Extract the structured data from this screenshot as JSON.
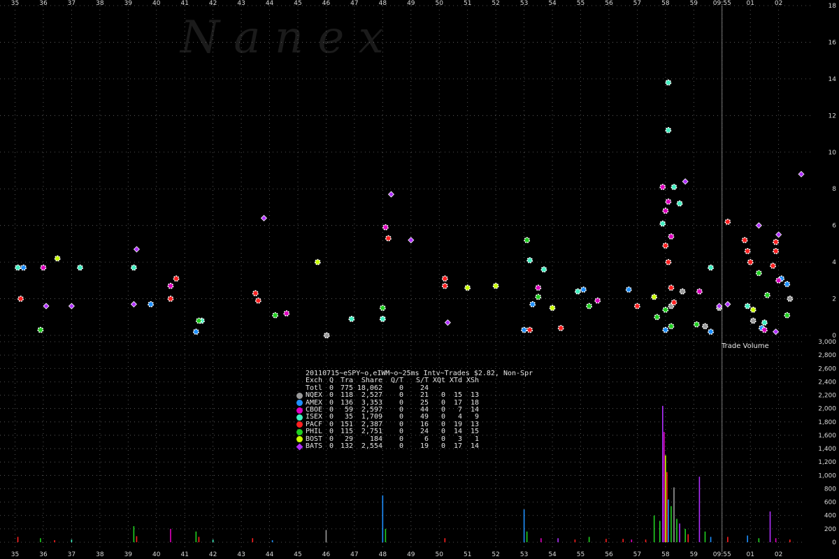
{
  "chart_data": [
    {
      "type": "scatter",
      "title": "",
      "watermark": "N a n e x",
      "xlabel": "",
      "ylabel": "",
      "x_time_labels": [
        "35",
        "36",
        "37",
        "38",
        "39",
        "40",
        "41",
        "42",
        "43",
        "44",
        "45",
        "46",
        "47",
        "48",
        "49",
        "50",
        "51",
        "52",
        "53",
        "54",
        "55",
        "56",
        "57",
        "58",
        "59",
        "09:55",
        "01",
        "02"
      ],
      "ylim": [
        0,
        18
      ],
      "y_tick_labels": [
        "0",
        "2",
        "4",
        "6",
        "8",
        "10",
        "12",
        "14",
        "16",
        "18"
      ],
      "grid": true,
      "marker_line_time": "09:55",
      "series": [
        {
          "name": "NQEX",
          "color": "#9a9a9a",
          "shape": "circle",
          "points": [
            [
              46.02,
              0
            ],
            [
              58.2,
              1.6
            ],
            [
              58.6,
              2.4
            ],
            [
              59.4,
              0.5
            ],
            [
              59.9,
              1.5
            ],
            [
              1.1,
              0.8
            ],
            [
              2.4,
              2.0
            ]
          ]
        },
        {
          "name": "AMEX",
          "color": "#1e90ff",
          "shape": "circle",
          "points": [
            [
              35.3,
              3.7
            ],
            [
              39.8,
              1.7
            ],
            [
              41.4,
              0.2
            ],
            [
              48.0,
              0.9
            ],
            [
              53.0,
              0.3
            ],
            [
              53.3,
              1.7
            ],
            [
              55.1,
              2.5
            ],
            [
              56.7,
              2.5
            ],
            [
              58.0,
              0.3
            ],
            [
              59.6,
              0.2
            ],
            [
              1.4,
              0.4
            ],
            [
              2.1,
              3.1
            ],
            [
              2.3,
              2.8
            ]
          ]
        },
        {
          "name": "CBOE",
          "color": "#e000c0",
          "shape": "circle",
          "points": [
            [
              36.0,
              3.7
            ],
            [
              40.5,
              2.7
            ],
            [
              44.6,
              1.2
            ],
            [
              48.1,
              5.9
            ],
            [
              53.5,
              2.6
            ],
            [
              55.6,
              1.9
            ],
            [
              57.9,
              8.1
            ],
            [
              58.1,
              7.3
            ],
            [
              58.0,
              6.8
            ],
            [
              58.2,
              5.4
            ],
            [
              59.2,
              2.4
            ],
            [
              1.5,
              0.3
            ],
            [
              2.0,
              3.0
            ]
          ]
        },
        {
          "name": "ISEX",
          "color": "#40f0c0",
          "shape": "circle",
          "points": [
            [
              35.1,
              3.7
            ],
            [
              37.3,
              3.7
            ],
            [
              39.2,
              3.7
            ],
            [
              41.6,
              0.8
            ],
            [
              46.9,
              0.9
            ],
            [
              48.0,
              0.9
            ],
            [
              53.2,
              4.1
            ],
            [
              53.7,
              3.6
            ],
            [
              54.9,
              2.4
            ],
            [
              57.9,
              6.1
            ],
            [
              58.3,
              8.1
            ],
            [
              58.5,
              7.2
            ],
            [
              58.1,
              11.2
            ],
            [
              58.1,
              13.8
            ],
            [
              59.6,
              3.7
            ],
            [
              0.9,
              1.6
            ],
            [
              1.5,
              0.7
            ]
          ]
        },
        {
          "name": "PACF",
          "color": "#ff2020",
          "shape": "circle",
          "points": [
            [
              35.2,
              2.0
            ],
            [
              40.5,
              2.0
            ],
            [
              40.7,
              3.1
            ],
            [
              43.5,
              2.3
            ],
            [
              43.6,
              1.9
            ],
            [
              48.2,
              5.3
            ],
            [
              50.2,
              2.7
            ],
            [
              50.2,
              3.1
            ],
            [
              53.2,
              0.3
            ],
            [
              54.3,
              0.4
            ],
            [
              57.0,
              1.6
            ],
            [
              58.0,
              4.9
            ],
            [
              58.1,
              4.0
            ],
            [
              58.2,
              2.6
            ],
            [
              58.3,
              1.8
            ],
            [
              0.2,
              6.2
            ],
            [
              0.8,
              5.2
            ],
            [
              0.9,
              4.6
            ],
            [
              1.0,
              4.0
            ],
            [
              1.9,
              4.6
            ],
            [
              1.8,
              3.8
            ],
            [
              1.9,
              5.1
            ]
          ]
        },
        {
          "name": "PHIL",
          "color": "#20d020",
          "shape": "circle",
          "points": [
            [
              35.9,
              0.3
            ],
            [
              41.5,
              0.8
            ],
            [
              44.2,
              1.1
            ],
            [
              48.0,
              1.5
            ],
            [
              53.1,
              5.2
            ],
            [
              53.5,
              2.1
            ],
            [
              55.3,
              1.6
            ],
            [
              57.7,
              1.0
            ],
            [
              58.0,
              1.4
            ],
            [
              58.2,
              0.5
            ],
            [
              59.1,
              0.6
            ],
            [
              1.3,
              3.4
            ],
            [
              1.6,
              2.2
            ],
            [
              2.3,
              1.1
            ]
          ]
        },
        {
          "name": "BOST",
          "color": "#c8ff00",
          "shape": "circle",
          "points": [
            [
              36.5,
              4.2
            ],
            [
              45.7,
              4.0
            ],
            [
              51.0,
              2.6
            ],
            [
              52.0,
              2.7
            ],
            [
              54.0,
              1.5
            ],
            [
              57.6,
              2.1
            ],
            [
              1.1,
              1.4
            ]
          ]
        },
        {
          "name": "BATS",
          "color": "#b030ff",
          "shape": "diamond",
          "points": [
            [
              36.1,
              1.6
            ],
            [
              37.0,
              1.6
            ],
            [
              39.2,
              1.7
            ],
            [
              39.3,
              4.7
            ],
            [
              43.8,
              6.4
            ],
            [
              48.3,
              7.7
            ],
            [
              49.0,
              5.2
            ],
            [
              50.3,
              0.7
            ],
            [
              58.7,
              8.4
            ],
            [
              59.9,
              1.6
            ],
            [
              0.2,
              1.7
            ],
            [
              1.3,
              6.0
            ],
            [
              1.9,
              0.2
            ],
            [
              2.0,
              5.5
            ],
            [
              2.8,
              8.8
            ]
          ]
        }
      ]
    },
    {
      "type": "bar",
      "title": "Trade Volume",
      "ylim": [
        0,
        3000
      ],
      "y_tick_labels": [
        "0",
        "200",
        "400",
        "600",
        "800",
        "1,000",
        "1,200",
        "1,400",
        "1,600",
        "1,800",
        "2,000",
        "2,200",
        "2,400",
        "2,600",
        "2,800",
        "3,000"
      ],
      "x_time_labels": [
        "35",
        "36",
        "37",
        "38",
        "39",
        "40",
        "41",
        "42",
        "43",
        "44",
        "45",
        "46",
        "47",
        "48",
        "49",
        "50",
        "51",
        "52",
        "53",
        "54",
        "55",
        "56",
        "57",
        "58",
        "59",
        "09:55",
        "01",
        "02"
      ],
      "bars": [
        {
          "t": 35.1,
          "v": 80,
          "color": "#ff2020"
        },
        {
          "t": 35.9,
          "v": 60,
          "color": "#20d020"
        },
        {
          "t": 36.4,
          "v": 30,
          "color": "#ff2020"
        },
        {
          "t": 37.0,
          "v": 40,
          "color": "#40f0c0"
        },
        {
          "t": 39.2,
          "v": 240,
          "color": "#20d020"
        },
        {
          "t": 39.3,
          "v": 90,
          "color": "#ff2020"
        },
        {
          "t": 40.5,
          "v": 200,
          "color": "#e000c0"
        },
        {
          "t": 41.4,
          "v": 160,
          "color": "#20d020"
        },
        {
          "t": 41.5,
          "v": 80,
          "color": "#ff2020"
        },
        {
          "t": 42.0,
          "v": 40,
          "color": "#40f0c0"
        },
        {
          "t": 43.4,
          "v": 60,
          "color": "#ff2020"
        },
        {
          "t": 44.1,
          "v": 30,
          "color": "#1e90ff"
        },
        {
          "t": 46.0,
          "v": 180,
          "color": "#9a9a9a"
        },
        {
          "t": 48.0,
          "v": 700,
          "color": "#1e90ff"
        },
        {
          "t": 48.1,
          "v": 200,
          "color": "#20d020"
        },
        {
          "t": 50.2,
          "v": 60,
          "color": "#ff2020"
        },
        {
          "t": 53.0,
          "v": 490,
          "color": "#1e90ff"
        },
        {
          "t": 53.1,
          "v": 160,
          "color": "#20d020"
        },
        {
          "t": 53.6,
          "v": 60,
          "color": "#e000c0"
        },
        {
          "t": 54.2,
          "v": 60,
          "color": "#b030ff"
        },
        {
          "t": 54.8,
          "v": 40,
          "color": "#ff2020"
        },
        {
          "t": 55.3,
          "v": 80,
          "color": "#20d020"
        },
        {
          "t": 55.9,
          "v": 50,
          "color": "#ff2020"
        },
        {
          "t": 56.5,
          "v": 50,
          "color": "#ff2020"
        },
        {
          "t": 56.8,
          "v": 40,
          "color": "#e000c0"
        },
        {
          "t": 57.3,
          "v": 40,
          "color": "#ff2020"
        },
        {
          "t": 57.6,
          "v": 400,
          "color": "#20d020"
        },
        {
          "t": 57.8,
          "v": 320,
          "color": "#20d020"
        },
        {
          "t": 57.9,
          "v": 2040,
          "color": "#b030ff"
        },
        {
          "t": 57.95,
          "v": 1650,
          "color": "#e000c0"
        },
        {
          "t": 58.0,
          "v": 1300,
          "color": "#c8ff00"
        },
        {
          "t": 58.05,
          "v": 1050,
          "color": "#ff2020"
        },
        {
          "t": 58.1,
          "v": 640,
          "color": "#1e90ff"
        },
        {
          "t": 58.2,
          "v": 540,
          "color": "#20d020"
        },
        {
          "t": 58.3,
          "v": 820,
          "color": "#9a9a9a"
        },
        {
          "t": 58.4,
          "v": 350,
          "color": "#20d020"
        },
        {
          "t": 58.5,
          "v": 280,
          "color": "#b030ff"
        },
        {
          "t": 58.7,
          "v": 200,
          "color": "#20d020"
        },
        {
          "t": 58.8,
          "v": 120,
          "color": "#ff2020"
        },
        {
          "t": 59.2,
          "v": 980,
          "color": "#b030ff"
        },
        {
          "t": 59.4,
          "v": 160,
          "color": "#20d020"
        },
        {
          "t": 59.6,
          "v": 80,
          "color": "#1e90ff"
        },
        {
          "t": 0.2,
          "v": 80,
          "color": "#ff2020"
        },
        {
          "t": 0.9,
          "v": 100,
          "color": "#1e90ff"
        },
        {
          "t": 1.3,
          "v": 60,
          "color": "#20d020"
        },
        {
          "t": 1.7,
          "v": 460,
          "color": "#b030ff"
        },
        {
          "t": 1.9,
          "v": 60,
          "color": "#e000c0"
        },
        {
          "t": 2.4,
          "v": 40,
          "color": "#ff2020"
        }
      ]
    }
  ],
  "legend": {
    "title": "20110715~eSPY~o,eIWM~o~25ms Intv~Trades $2.82, Non-Spr",
    "header": {
      "exch": "Exch",
      "q": "Q",
      "tra": "Tra",
      "share": "Share",
      "qt": "Q/T",
      "st": "S/T",
      "xqt": "XQt",
      "xtd": "XTd",
      "xsh": "XSh"
    },
    "rows": [
      {
        "exch": "Totl",
        "q": "0",
        "tra": "775",
        "share": "18,062",
        "qt": "0",
        "st": "24",
        "xqt": "",
        "xtd": "",
        "xsh": "",
        "color": "",
        "shape": "none"
      },
      {
        "exch": "NQEX",
        "q": "0",
        "tra": "118",
        "share": "2,527",
        "qt": "0",
        "st": "21",
        "xqt": "0",
        "xtd": "15",
        "xsh": "13",
        "color": "#9a9a9a",
        "shape": "circle"
      },
      {
        "exch": "AMEX",
        "q": "0",
        "tra": "136",
        "share": "3,353",
        "qt": "0",
        "st": "25",
        "xqt": "0",
        "xtd": "17",
        "xsh": "18",
        "color": "#1e90ff",
        "shape": "circle"
      },
      {
        "exch": "CBOE",
        "q": "0",
        "tra": "59",
        "share": "2,597",
        "qt": "0",
        "st": "44",
        "xqt": "0",
        "xtd": "7",
        "xsh": "14",
        "color": "#e000c0",
        "shape": "circle"
      },
      {
        "exch": "ISEX",
        "q": "0",
        "tra": "35",
        "share": "1,709",
        "qt": "0",
        "st": "49",
        "xqt": "0",
        "xtd": "4",
        "xsh": "9",
        "color": "#40f0c0",
        "shape": "circle"
      },
      {
        "exch": "PACF",
        "q": "0",
        "tra": "151",
        "share": "2,387",
        "qt": "0",
        "st": "16",
        "xqt": "0",
        "xtd": "19",
        "xsh": "13",
        "color": "#ff2020",
        "shape": "circle"
      },
      {
        "exch": "PHIL",
        "q": "0",
        "tra": "115",
        "share": "2,751",
        "qt": "0",
        "st": "24",
        "xqt": "0",
        "xtd": "14",
        "xsh": "15",
        "color": "#20d020",
        "shape": "circle"
      },
      {
        "exch": "BOST",
        "q": "0",
        "tra": "29",
        "share": "184",
        "qt": "0",
        "st": "6",
        "xqt": "0",
        "xtd": "3",
        "xsh": "1",
        "color": "#c8ff00",
        "shape": "circle"
      },
      {
        "exch": "BATS",
        "q": "0",
        "tra": "132",
        "share": "2,554",
        "qt": "0",
        "st": "19",
        "xqt": "0",
        "xtd": "17",
        "xsh": "14",
        "color": "#b030ff",
        "shape": "diamond"
      }
    ]
  }
}
